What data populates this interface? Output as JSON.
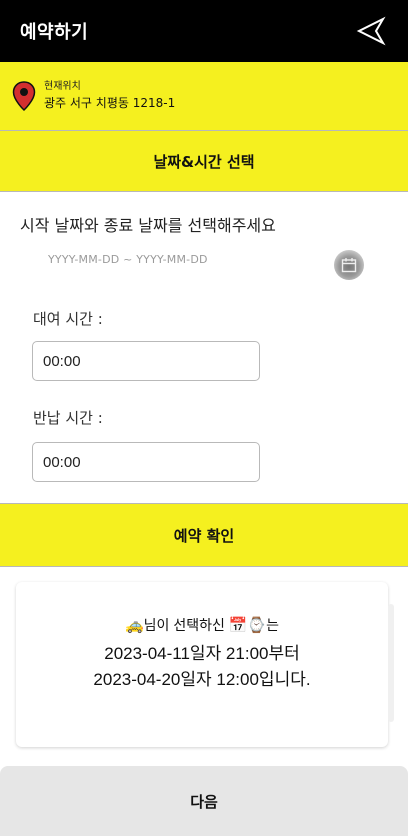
{
  "header": {
    "title": "예약하기"
  },
  "location": {
    "label": "현재위치",
    "address": "광주 서구 치평동 1218-1"
  },
  "date_section": {
    "title": "날짜&시간 선택"
  },
  "date_range": {
    "prompt": "시작 날짜와 종료 날짜를 선택해주세요",
    "placeholder": "YYYY-MM-DD ~ YYYY-MM-DD"
  },
  "rental": {
    "label": "대여 시간 :",
    "value": "00:00"
  },
  "return": {
    "label": "반납 시간 :",
    "value": "00:00"
  },
  "confirm": {
    "title": "예약 확인"
  },
  "summary": {
    "car_emoji": "🚕",
    "text1": "님이 선택하신",
    "calendar_emoji": "📅",
    "watch_emoji": "⌚",
    "text2": "는",
    "start": "2023-04-11일자 21:00부터",
    "end": "2023-04-20일자 12:00입니다."
  },
  "footer": {
    "next_label": "다음"
  },
  "colors": {
    "accent": "#f5f01f",
    "header_bg": "#000000",
    "pin": "#d32f2f"
  }
}
